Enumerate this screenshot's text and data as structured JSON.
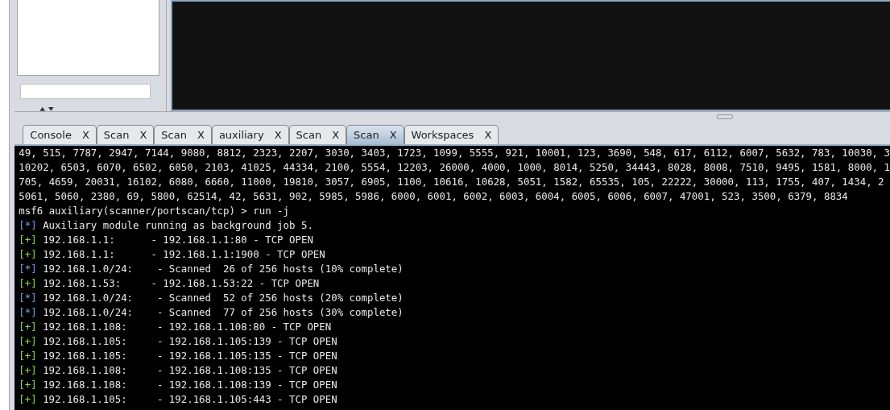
{
  "tabs": [
    {
      "label": "Console",
      "close": "X",
      "selected": false
    },
    {
      "label": "Scan",
      "close": "X",
      "selected": false
    },
    {
      "label": "Scan",
      "close": "X",
      "selected": false
    },
    {
      "label": "auxiliary",
      "close": "X",
      "selected": false
    },
    {
      "label": "Scan",
      "close": "X",
      "selected": false
    },
    {
      "label": "Scan",
      "close": "X",
      "selected": true
    },
    {
      "label": "Workspaces",
      "close": "X",
      "selected": false
    }
  ],
  "console": {
    "lines": [
      {
        "kind": "plain",
        "text": "49, 515, 7787, 2947, 7144, 9080, 8812, 2323, 2207, 3030, 3403, 1723, 1099, 5555, 921, 10001, 123, 3690, 548, 617, 6112, 6007, 5632, 783, 10030, 3"
      },
      {
        "kind": "plain",
        "text": "10202, 6503, 6070, 6502, 6050, 2103, 41025, 44334, 2100, 5554, 12203, 26000, 4000, 1000, 8014, 5250, 34443, 8028, 8008, 7510, 9495, 1581, 8000, 1"
      },
      {
        "kind": "plain",
        "text": "705, 4659, 20031, 16102, 6080, 6660, 11000, 19810, 3057, 6905, 1100, 10616, 10628, 5051, 1582, 65535, 105, 22222, 30000, 113, 1755, 407, 1434, 2"
      },
      {
        "kind": "plain",
        "text": "5061, 5060, 2380, 69, 5800, 62514, 42, 5631, 902, 5985, 5986, 6000, 6001, 6002, 6003, 6004, 6005, 6006, 6007, 47001, 523, 3500, 6379, 8834"
      },
      {
        "kind": "plain",
        "text": "msf6 auxiliary(scanner/portscan/tcp) > run -j"
      },
      {
        "kind": "info",
        "marker": "[*]",
        "text": "Auxiliary module running as background job 5."
      },
      {
        "kind": "good",
        "marker": "[+]",
        "text": "192.168.1.1:      - 192.168.1.1:80 - TCP OPEN"
      },
      {
        "kind": "good",
        "marker": "[+]",
        "text": "192.168.1.1:      - 192.168.1.1:1900 - TCP OPEN"
      },
      {
        "kind": "info",
        "marker": "[*]",
        "text": "192.168.1.0/24:    - Scanned  26 of 256 hosts (10% complete)"
      },
      {
        "kind": "good",
        "marker": "[+]",
        "text": "192.168.1.53:     - 192.168.1.53:22 - TCP OPEN"
      },
      {
        "kind": "info",
        "marker": "[*]",
        "text": "192.168.1.0/24:    - Scanned  52 of 256 hosts (20% complete)"
      },
      {
        "kind": "info",
        "marker": "[*]",
        "text": "192.168.1.0/24:    - Scanned  77 of 256 hosts (30% complete)"
      },
      {
        "kind": "good",
        "marker": "[+]",
        "text": "192.168.1.108:     - 192.168.1.108:80 - TCP OPEN"
      },
      {
        "kind": "good",
        "marker": "[+]",
        "text": "192.168.1.105:     - 192.168.1.105:139 - TCP OPEN"
      },
      {
        "kind": "good",
        "marker": "[+]",
        "text": "192.168.1.105:     - 192.168.1.105:135 - TCP OPEN"
      },
      {
        "kind": "good",
        "marker": "[+]",
        "text": "192.168.1.108:     - 192.168.1.108:135 - TCP OPEN"
      },
      {
        "kind": "good",
        "marker": "[+]",
        "text": "192.168.1.108:     - 192.168.1.108:139 - TCP OPEN"
      },
      {
        "kind": "good",
        "marker": "[+]",
        "text": "192.168.1.105:     - 192.168.1.105:443 - TCP OPEN"
      }
    ]
  }
}
